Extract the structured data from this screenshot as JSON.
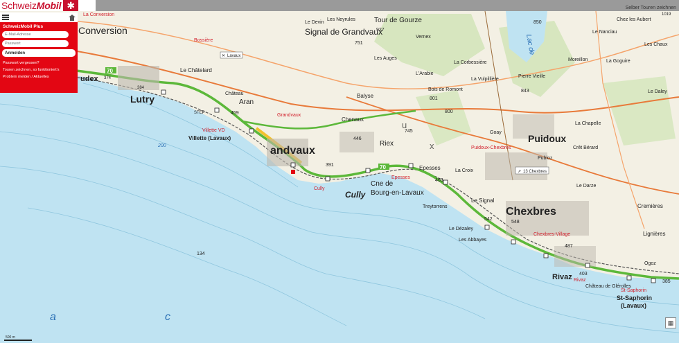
{
  "brand": {
    "name_plain": "Schweiz",
    "name_bold": "Mobil",
    "star": "✱"
  },
  "top_hint": "Selber Touren zeichnen",
  "panel": {
    "title": "SchweizMobil Plus",
    "email_placeholder": "E-Mail-Adresse",
    "password_placeholder": "Passwort",
    "login_label": "Anmelden",
    "links": [
      "Passwort vergessen?",
      "Touren zeichnen, so funktioniert's",
      "Problem melden / Aktuelles"
    ]
  },
  "colors": {
    "lake": "#bfe3f2",
    "land": "#f4f1e6",
    "route": "#5cb83a",
    "road": "#e87a3a",
    "highlight": "#f2c12e",
    "brand_red": "#e30613"
  },
  "places": {
    "conversion": "Conversion",
    "la_conversion": "La Conversion",
    "lutry": "Lutry",
    "udex": "udex",
    "le_chatelard": "Le Châtelard",
    "bossiere": "Bossière",
    "lavaux": "Lavaux",
    "aran": "Aran",
    "chateau": "Château",
    "grandvaux_mid": "Grandvaux",
    "villette_vd": "Villette VD",
    "villette_lavaux": "Villette (Lavaux)",
    "grandvaux": "andvaux",
    "cully": "Cully",
    "cully_red": "Cully",
    "riex": "Riex",
    "chenaux": "Chenaux",
    "balyse": "Balyse",
    "cne_de": "Cne de",
    "bourg": "Bourg-en-Lavaux",
    "epesses": "Epesses",
    "epesses_red": "Epesses",
    "la_croix": "La Croix",
    "treytorrens": "Treytorrens",
    "le_signal": "Le Signal",
    "le_dezaley": "Le Dézaley",
    "les_abbayes": "Les Abbayes",
    "chexbres": "Chexbres",
    "chexbres_village": "Chexbres-Village",
    "chexbres_tag": "13 Chexbres",
    "puidoux": "Puidoux",
    "puidoux_chexbres": "Puidoux-Chexbres",
    "publoz": "Publoz",
    "rivaz": "Rivaz",
    "rivaz_red": "Rivaz",
    "chateau_glerolles": "Château de Glérolles",
    "st_saphorin_red": "St-Saphorin",
    "st_saphorin": "St-Saphorin",
    "lavaux_paren": "(Lavaux)",
    "signal_de_grandvaux": "Signal de Grandvaux",
    "tour_de_gourze": "Tour de Gourze",
    "cremieres": "Cremières",
    "lignieres": "Lignières",
    "pierre_vieille": "Pierre Vieille",
    "bois_de_romont": "Bois de Romont",
    "larabie": "L'Arabie",
    "la_corbessiere": "La Corbessière",
    "le_devin": "Le Devin",
    "les_neyrules": "Les Neyrules",
    "les_auges": "Les Auges",
    "la_vulpilliere": "La Vulpillière",
    "vernex": "Vernex",
    "moreillon": "Moreillon",
    "le_nanciau": "Le Nanciau",
    "chez_les_aubert": "Chez les Aubert",
    "les_chaux": "Les Chaux",
    "la_goguire": "La Goguire",
    "le_daley": "Le Daley",
    "goay": "Goay",
    "cret_berard": "Crêt Bérard",
    "la_chapelle": "La Chapelle",
    "le_darze": "Le Darze",
    "ogoz": "Ogoz",
    "step": "STEP",
    "lake_a": "a",
    "lake_c": "c",
    "lake_u": "u",
    "lake_x": "x",
    "lac_de": "Lac de"
  },
  "route_number": "70",
  "elevations": [
    "134",
    "200",
    "384",
    "374",
    "927",
    "751",
    "800",
    "801",
    "843",
    "850",
    "745",
    "459",
    "446",
    "391",
    "463",
    "548",
    "542",
    "487",
    "403",
    "385",
    "1019"
  ],
  "scale_label": "500 m"
}
